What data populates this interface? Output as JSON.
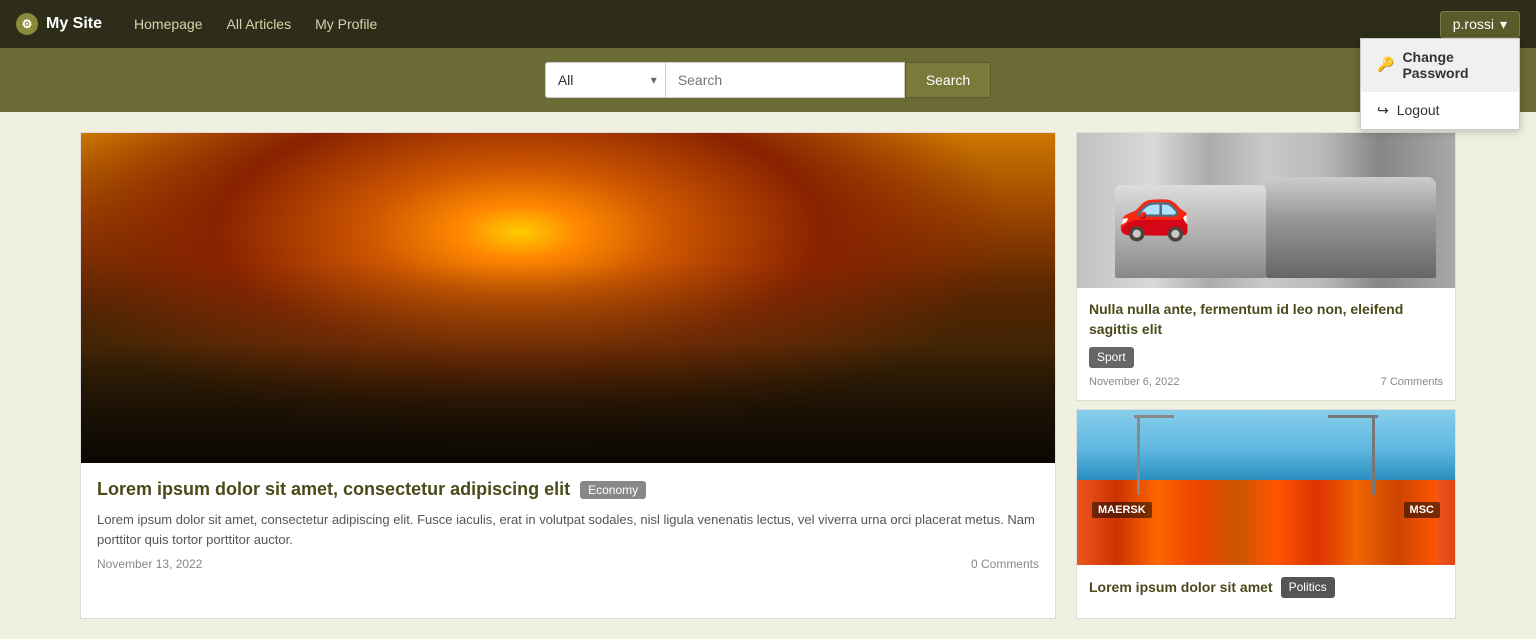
{
  "site": {
    "brand": "My Site",
    "brand_icon": "⚙"
  },
  "nav": {
    "links": [
      {
        "label": "Homepage",
        "href": "#"
      },
      {
        "label": "All Articles",
        "href": "#"
      },
      {
        "label": "My Profile",
        "href": "#"
      }
    ],
    "user": {
      "username": "p.rossi",
      "dropdown_arrow": "▾"
    },
    "dropdown": {
      "items": [
        {
          "label": "Change Password",
          "icon": "🔑"
        },
        {
          "label": "Logout",
          "icon": "↪"
        }
      ]
    }
  },
  "search": {
    "category_placeholder": "All",
    "input_placeholder": "Search",
    "button_label": "Search",
    "categories": [
      "All",
      "Economy",
      "Sport",
      "Politics"
    ]
  },
  "featured": {
    "title": "Lorem ipsum dolor sit amet, consectetur adipiscing elit",
    "tag": "Economy",
    "tag_class": "tag-economy",
    "excerpt": "Lorem ipsum dolor sit amet, consectetur adipiscing elit. Fusce iaculis, erat in volutpat sodales, nisl ligula venenatis lectus, vel viverra urna orci placerat metus. Nam porttitor quis tortor porttitor auctor.",
    "date": "November 13, 2022",
    "comments": "0 Comments"
  },
  "sidebar": {
    "articles": [
      {
        "title": "Nulla nulla ante, fermentum id leo non, eleifend sagittis elit",
        "tag": "Sport",
        "tag_class": "tag-sport",
        "date": "November 6, 2022",
        "comments": "7 Comments",
        "image_type": "cars"
      },
      {
        "title": "Lorem ipsum dolor sit amet",
        "tag": "Politics",
        "tag_class": "tag-politics",
        "date": "",
        "comments": "",
        "image_type": "ship"
      }
    ]
  },
  "colors": {
    "nav_bg": "#2d2d1a",
    "search_bg": "#6b6b35",
    "accent": "#4a4a1a"
  }
}
